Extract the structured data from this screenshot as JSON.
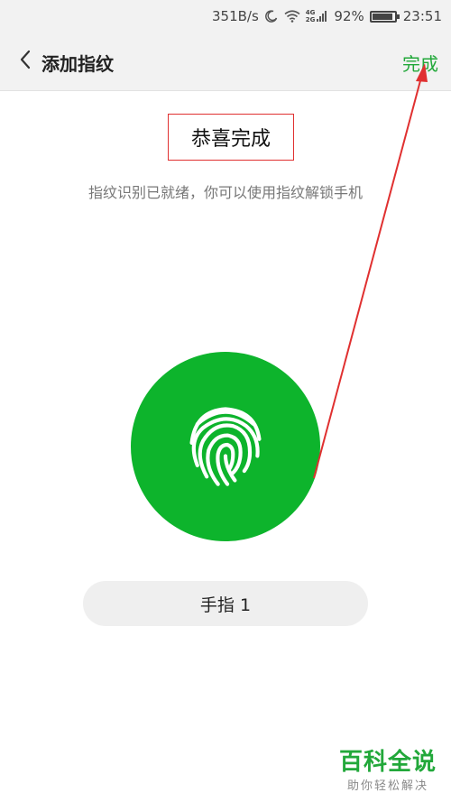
{
  "status_bar": {
    "net_speed": "351B/s",
    "net_type_top": "4G",
    "net_type_bottom": "2G",
    "battery_percent": "92%",
    "battery_level": 0.92,
    "time": "23:51",
    "icons": [
      "moon-icon",
      "wifi-icon",
      "signal-icon",
      "battery-icon"
    ]
  },
  "header": {
    "back_icon": "chevron-left-icon",
    "title": "添加指纹",
    "done_label": "完成"
  },
  "main": {
    "success_title": "恭喜完成",
    "subtitle": "指纹识别已就绪，你可以使用指纹解锁手机",
    "fingerprint_icon": "fingerprint-icon",
    "finger_item_label": "手指 1"
  },
  "watermark": {
    "main": "百科全说",
    "sub": "助你轻松解决"
  },
  "colors": {
    "accent": "#22a83a",
    "circle": "#0db42c",
    "annotation": "#e03030"
  }
}
